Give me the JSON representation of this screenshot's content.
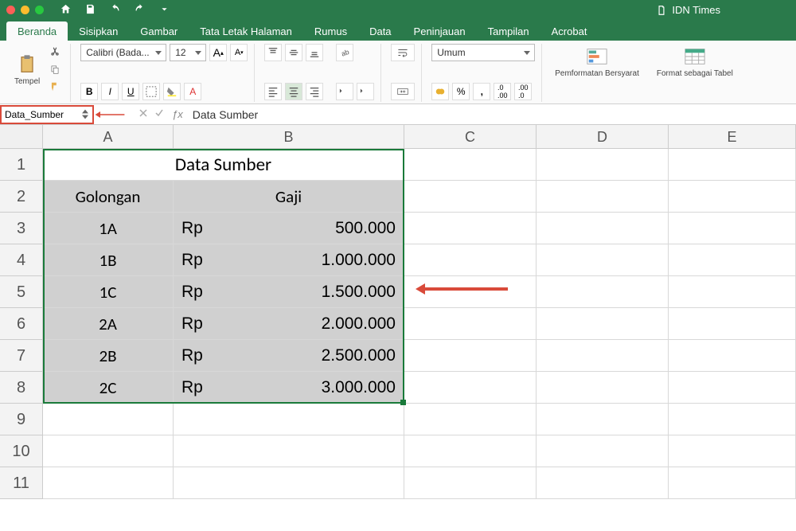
{
  "titlebar": {
    "doc": "IDN Times"
  },
  "tabs": [
    "Beranda",
    "Sisipkan",
    "Gambar",
    "Tata Letak Halaman",
    "Rumus",
    "Data",
    "Peninjauan",
    "Tampilan",
    "Acrobat"
  ],
  "ribbon": {
    "paste_label": "Tempel",
    "font_name": "Calibri (Bada...",
    "font_size": "12",
    "number_format": "Umum",
    "cond_fmt": "Pemformatan Bersyarat",
    "as_table": "Format sebagai Tabel"
  },
  "formula_bar": {
    "name_box": "Data_Sumber",
    "formula": "Data Sumber"
  },
  "grid": {
    "cols": [
      "A",
      "B",
      "C",
      "D",
      "E"
    ],
    "rows": [
      "1",
      "2",
      "3",
      "4",
      "5",
      "6",
      "7",
      "8",
      "9",
      "10",
      "11"
    ],
    "title": "Data Sumber",
    "headers": {
      "a": "Golongan",
      "b": "Gaji"
    },
    "data": [
      {
        "gol": "1A",
        "cur": "Rp",
        "amt": "500.000"
      },
      {
        "gol": "1B",
        "cur": "Rp",
        "amt": "1.000.000"
      },
      {
        "gol": "1C",
        "cur": "Rp",
        "amt": "1.500.000"
      },
      {
        "gol": "2A",
        "cur": "Rp",
        "amt": "2.000.000"
      },
      {
        "gol": "2B",
        "cur": "Rp",
        "amt": "2.500.000"
      },
      {
        "gol": "2C",
        "cur": "Rp",
        "amt": "3.000.000"
      }
    ]
  },
  "fx_label": "ƒx"
}
